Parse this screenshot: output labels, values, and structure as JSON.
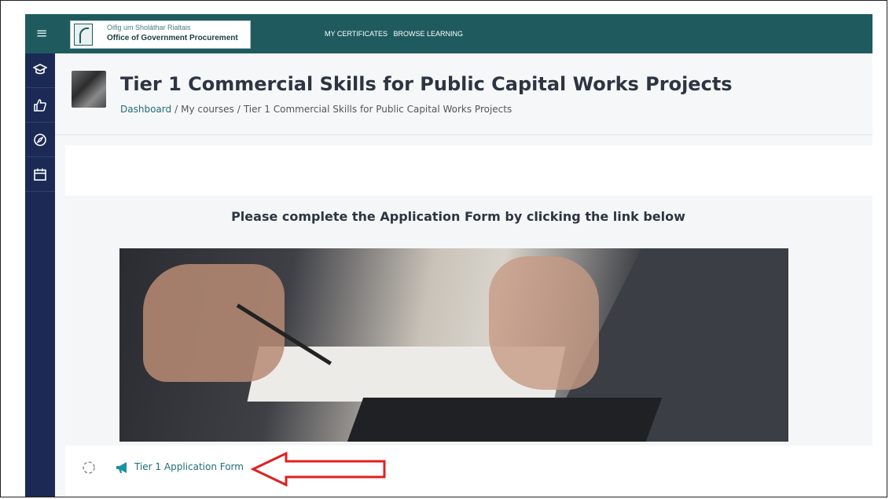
{
  "logo": {
    "line1": "Oifig um Sholáthar Rialtais",
    "line2": "Office of Government Procurement"
  },
  "topnav": {
    "items": [
      "MY CERTIFICATES",
      "BROWSE LEARNING"
    ]
  },
  "sidebar": {
    "icons": [
      "graduation-cap-icon",
      "thumbs-up-icon",
      "compass-icon",
      "calendar-icon"
    ]
  },
  "header": {
    "title": "Tier 1 Commercial Skills for Public Capital Works Projects",
    "breadcrumb": [
      "Dashboard",
      "My courses",
      "Tier 1 Commercial Skills for Public Capital Works Projects"
    ],
    "breadcrumb_separator": "/"
  },
  "main": {
    "heading": "Please complete the Application Form by clicking the link below",
    "activity": {
      "label": "Tier 1 Application Form",
      "icon": "megaphone-icon"
    }
  },
  "colors": {
    "topbar": "#1f5b5e",
    "sidebar": "#1b2a55",
    "link": "#1f6e76",
    "arrow": "#e02020"
  }
}
